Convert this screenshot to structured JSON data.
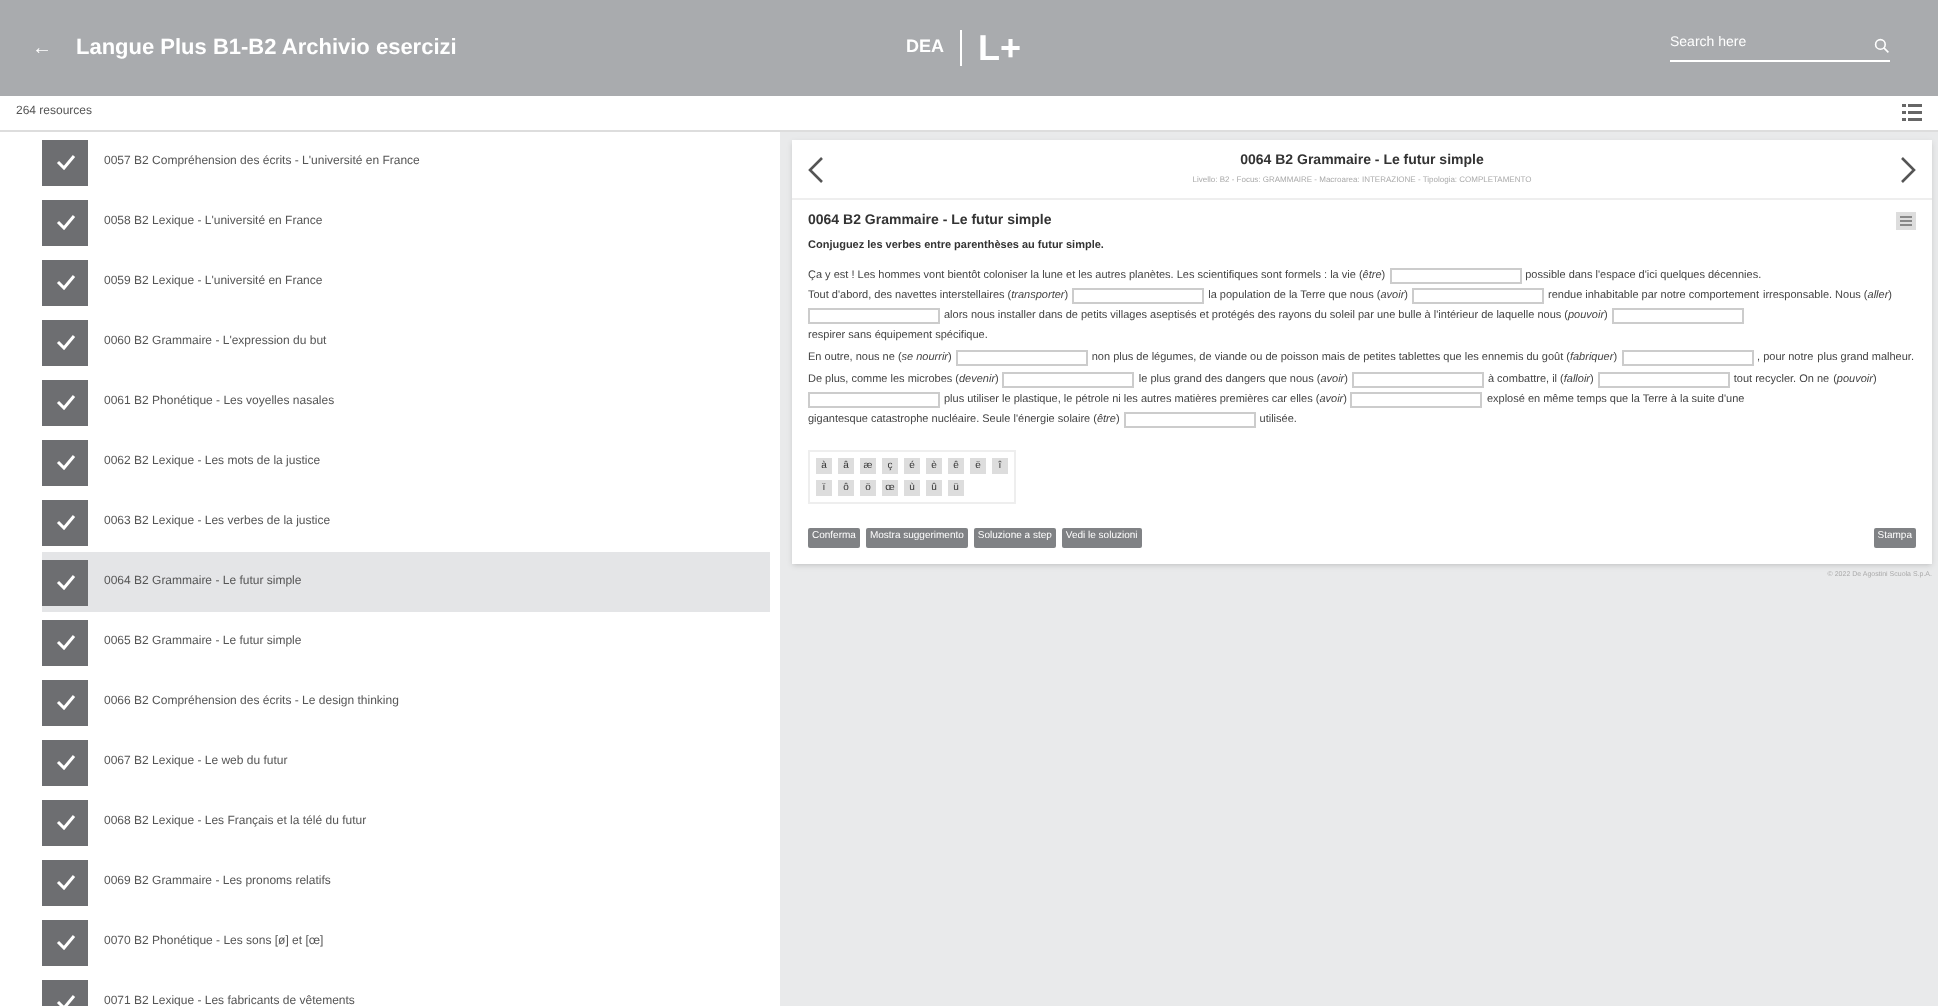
{
  "header": {
    "back": "←",
    "title": "Langue Plus B1-B2 Archivio esercizi",
    "logo": "DEA",
    "logo_mark": "L+",
    "search": {
      "placeholder": "Search here"
    }
  },
  "toolbar": {
    "count": "264 resources"
  },
  "sidebar": {
    "items": [
      {
        "label": "0057 B2 Compréhension des écrits - L'université en France",
        "checked": true,
        "selected": false
      },
      {
        "label": "0058 B2 Lexique - L'université en France",
        "checked": true,
        "selected": false
      },
      {
        "label": "0059 B2 Lexique - L'université en France",
        "checked": true,
        "selected": false
      },
      {
        "label": "0060 B2 Grammaire - L'expression du but",
        "checked": true,
        "selected": false
      },
      {
        "label": "0061 B2 Phonétique - Les voyelles nasales",
        "checked": true,
        "selected": false
      },
      {
        "label": "0062 B2 Lexique - Les mots de la justice",
        "checked": true,
        "selected": false
      },
      {
        "label": "0063 B2 Lexique - Les verbes de la justice",
        "checked": true,
        "selected": false
      },
      {
        "label": "0064 B2 Grammaire - Le futur simple",
        "checked": true,
        "selected": true
      },
      {
        "label": "0065 B2 Grammaire - Le futur simple",
        "checked": true,
        "selected": false
      },
      {
        "label": "0066 B2 Compréhension des écrits - Le design thinking",
        "checked": true,
        "selected": false
      },
      {
        "label": "0067 B2 Lexique - Le web du futur",
        "checked": true,
        "selected": false
      },
      {
        "label": "0068 B2 Lexique - Les Français et la télé du futur",
        "checked": true,
        "selected": false
      },
      {
        "label": "0069 B2 Grammaire - Les pronoms relatifs",
        "checked": true,
        "selected": false
      },
      {
        "label": "0070 B2 Phonétique - Les sons [ø] et [œ]",
        "checked": true,
        "selected": false
      },
      {
        "label": "0071 B2 Lexique - Les fabricants de vêtements",
        "checked": true,
        "selected": false
      }
    ]
  },
  "exercise": {
    "title": "0064 B2 Grammaire - Le futur simple",
    "meta": "Livello: B2 - Focus: GRAMMAIRE - Macroarea: INTERAZIONE - Tipologia: COMPLETAMENTO",
    "heading": "0064 B2 Grammaire - Le futur simple",
    "instruction": "Conjuguez les verbes entre parenthèses au futur simple.",
    "paragraphs": [
      [
        {
          "kind": "text",
          "text": "Ça y est ! Les hommes vont bientôt coloniser la lune et les autres planètes. Les scientifiques sont formels : la vie (*être*)"
        },
        {
          "kind": "blank"
        },
        {
          "kind": "text",
          "text": "possible dans l'espace d'ici quelques décennies."
        },
        {
          "kind": "text",
          "text": "Tout d'abord, des navettes interstellaires (*transporter*)"
        },
        {
          "kind": "blank"
        },
        {
          "kind": "text",
          "text": "la population de la Terre que nous (*avoir*)"
        },
        {
          "kind": "blank"
        },
        {
          "kind": "text",
          "text": "rendue inhabitable par notre comportement"
        },
        {
          "kind": "text",
          "text": "irresponsable. Nous (*aller*)"
        },
        {
          "kind": "blank"
        },
        {
          "kind": "text",
          "text": "alors nous installer dans de petits villages aseptisés et protégés des rayons du soleil par une bulle à l'intérieur de laquelle nous (*pouvoir*)"
        },
        {
          "kind": "blank"
        },
        {
          "kind": "text",
          "text": "respirer sans équipement spécifique."
        }
      ],
      [
        {
          "kind": "text",
          "text": "En outre, nous ne (*se nourrir*)"
        },
        {
          "kind": "blank"
        },
        {
          "kind": "text",
          "text": "non plus de légumes, de viande ou de poisson mais de petites tablettes que les ennemis du goût (*fabriquer*)"
        },
        {
          "kind": "blank"
        },
        {
          "kind": "text",
          "text": ", pour notre"
        },
        {
          "kind": "text",
          "text": "plus grand malheur."
        }
      ],
      [
        {
          "kind": "text",
          "text": "De plus, comme les microbes (*devenir*)"
        },
        {
          "kind": "blank"
        },
        {
          "kind": "text",
          "text": "le plus grand des dangers que nous (*avoir*)"
        },
        {
          "kind": "blank"
        },
        {
          "kind": "text",
          "text": "à combattre, il (*falloir*)"
        },
        {
          "kind": "blank"
        },
        {
          "kind": "text",
          "text": "tout recycler. On ne"
        },
        {
          "kind": "text",
          "text": "(*pouvoir*)"
        },
        {
          "kind": "blank"
        },
        {
          "kind": "text",
          "text": "plus utiliser le plastique, le pétrole ni les autres matières premières car elles (*avoir*)"
        },
        {
          "kind": "blank"
        },
        {
          "kind": "text",
          "text": "explosé en même temps que la Terre à la suite d'une"
        },
        {
          "kind": "text",
          "text": "gigantesque catastrophe nucléaire. Seule l'énergie solaire (*être*)"
        },
        {
          "kind": "blank"
        },
        {
          "kind": "text",
          "text": "utilisée."
        }
      ]
    ],
    "keys": [
      [
        "à",
        "â",
        "æ",
        "ç",
        "é",
        "è",
        "ê",
        "ë",
        "î"
      ],
      [
        "ï",
        "ô",
        "ö",
        "œ",
        "ù",
        "û",
        "ü"
      ]
    ],
    "buttons": [
      "Conferma",
      "Mostra suggerimento",
      "Soluzione a step",
      "Vedi le soluzioni"
    ],
    "print": "Stampa"
  },
  "footer": "© 2022 De Agostini Scuola S.p.A."
}
